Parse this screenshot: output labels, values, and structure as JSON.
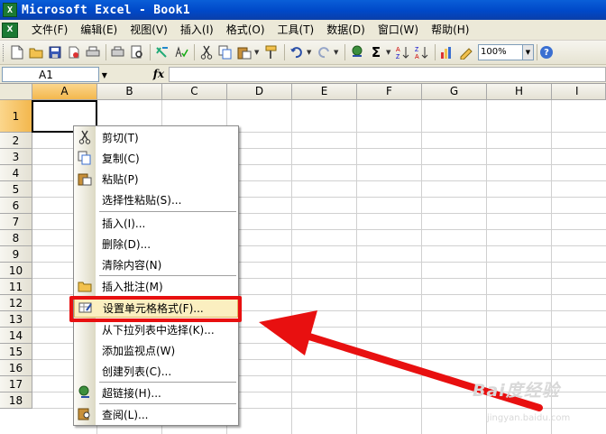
{
  "window": {
    "title": "Microsoft Excel - Book1",
    "logo": "X"
  },
  "menubar": {
    "items": [
      {
        "label": "文件(F)"
      },
      {
        "label": "编辑(E)"
      },
      {
        "label": "视图(V)"
      },
      {
        "label": "插入(I)"
      },
      {
        "label": "格式(O)"
      },
      {
        "label": "工具(T)"
      },
      {
        "label": "数据(D)"
      },
      {
        "label": "窗口(W)"
      },
      {
        "label": "帮助(H)"
      }
    ]
  },
  "toolbar": {
    "zoom": "100%",
    "icons": [
      "new-icon",
      "open-icon",
      "save-icon",
      "permission-icon",
      "print-icon",
      "print-preview-icon",
      "spelling-icon",
      "research-icon",
      "cut-icon",
      "copy-icon",
      "paste-icon",
      "format-painter-icon",
      "undo-icon",
      "redo-icon",
      "hyperlink-icon",
      "autosum-icon",
      "sort-asc-icon",
      "sort-desc-icon",
      "chart-icon",
      "drawing-icon",
      "help-icon"
    ],
    "glyphs": {
      "autosum": "Σ",
      "help": "?"
    }
  },
  "formula_bar": {
    "name_box": "A1",
    "fx": "fx",
    "value": ""
  },
  "grid": {
    "columns": [
      "A",
      "B",
      "C",
      "D",
      "E",
      "F",
      "G",
      "H",
      "I"
    ],
    "rows": [
      "1",
      "2",
      "3",
      "4",
      "5",
      "6",
      "7",
      "8",
      "9",
      "10",
      "11",
      "12",
      "13",
      "14",
      "15",
      "16",
      "17",
      "18"
    ],
    "selected_cell": "A1",
    "accent": "#f3b74d"
  },
  "context_menu": {
    "items": [
      {
        "label": "剪切(T)",
        "icon": "cut-icon"
      },
      {
        "label": "复制(C)",
        "icon": "copy-icon"
      },
      {
        "label": "粘贴(P)",
        "icon": "paste-icon"
      },
      {
        "label": "选择性粘贴(S)...",
        "icon": ""
      },
      {
        "label": "插入(I)...",
        "icon": ""
      },
      {
        "label": "删除(D)...",
        "icon": ""
      },
      {
        "label": "清除内容(N)",
        "icon": ""
      },
      {
        "label": "插入批注(M)",
        "icon": "comment-icon"
      },
      {
        "label": "设置单元格格式(F)...",
        "icon": "format-cells-icon",
        "highlighted": true
      },
      {
        "label": "从下拉列表中选择(K)...",
        "icon": ""
      },
      {
        "label": "添加监视点(W)",
        "icon": ""
      },
      {
        "label": "创建列表(C)...",
        "icon": ""
      },
      {
        "label": "超链接(H)...",
        "icon": "hyperlink-icon"
      },
      {
        "label": "查阅(L)...",
        "icon": "lookup-icon"
      }
    ]
  },
  "annotation": {
    "color": "#e81010"
  },
  "watermark": {
    "text": "Bai度经验",
    "sub": "jingyan.baidu.com"
  }
}
